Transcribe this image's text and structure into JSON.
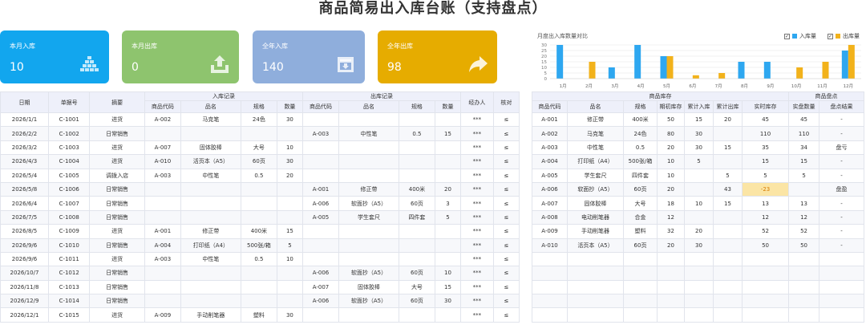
{
  "title": "商品简易出入库台账（支持盘点）",
  "tiles": [
    {
      "label": "本月入库",
      "value": "10",
      "color": "#12a6ee",
      "icon": "boxes-stack-icon"
    },
    {
      "label": "本月出库",
      "value": "0",
      "color": "#8ec46e",
      "icon": "upload-tray-icon"
    },
    {
      "label": "全年入库",
      "value": "140",
      "color": "#8faedc",
      "icon": "inbox-tray-icon"
    },
    {
      "label": "全年出库",
      "value": "98",
      "color": "#e6ac00",
      "icon": "share-arrow-icon"
    }
  ],
  "chart_data": {
    "type": "bar",
    "title": "月度出入库数量对比",
    "categories": [
      "1月",
      "2月",
      "3月",
      "4月",
      "5月",
      "6月",
      "7月",
      "8月",
      "9月",
      "10月",
      "11月",
      "12月"
    ],
    "series": [
      {
        "name": "入库量",
        "color": "#2ea7f0",
        "values": [
          30,
          0,
          10,
          30,
          20,
          0,
          0,
          15,
          15,
          0,
          0,
          25
        ]
      },
      {
        "name": "出库量",
        "color": "#f2b21b",
        "values": [
          0,
          15,
          0,
          0,
          20,
          3,
          5,
          0,
          0,
          10,
          15,
          30
        ]
      }
    ],
    "ylim": [
      0,
      30
    ],
    "yticks": [
      "0",
      "5",
      "10",
      "15",
      "20",
      "25",
      "30"
    ],
    "legend_position": "top-right",
    "grid": true
  },
  "log_table": {
    "group_headers": {
      "in": "入库记录",
      "out": "出库记录"
    },
    "headers": {
      "date": "日期",
      "doc_no": "单据号",
      "summary": "摘要",
      "in_code": "商品代码",
      "in_name": "品名",
      "in_spec": "规格",
      "in_qty": "数量",
      "out_code": "商品代码",
      "out_name": "品名",
      "out_spec": "规格",
      "out_qty": "数量",
      "handler": "经办人",
      "check": "核对"
    },
    "rows": [
      {
        "date": "2026/1/1",
        "doc": "C-1001",
        "summary": "进货",
        "in_code": "A-002",
        "in_name": "马克笔",
        "in_spec": "24色",
        "in_qty": "30",
        "out_code": "",
        "out_name": "",
        "out_spec": "",
        "out_qty": "",
        "handler": "***",
        "check": "≤"
      },
      {
        "date": "2026/2/2",
        "doc": "C-1002",
        "summary": "日常销售",
        "in_code": "",
        "in_name": "",
        "in_spec": "",
        "in_qty": "",
        "out_code": "A-003",
        "out_name": "中性笔",
        "out_spec": "0.5",
        "out_qty": "15",
        "handler": "***",
        "check": "≤"
      },
      {
        "date": "2026/3/2",
        "doc": "C-1003",
        "summary": "进货",
        "in_code": "A-007",
        "in_name": "固体胶棒",
        "in_spec": "大号",
        "in_qty": "10",
        "out_code": "",
        "out_name": "",
        "out_spec": "",
        "out_qty": "",
        "handler": "***",
        "check": "≤"
      },
      {
        "date": "2026/4/3",
        "doc": "C-1004",
        "summary": "进货",
        "in_code": "A-010",
        "in_name": "活页本（A5）",
        "in_spec": "60页",
        "in_qty": "30",
        "out_code": "",
        "out_name": "",
        "out_spec": "",
        "out_qty": "",
        "handler": "***",
        "check": "≤"
      },
      {
        "date": "2026/5/4",
        "doc": "C-1005",
        "summary": "调拨入店",
        "in_code": "A-003",
        "in_name": "中性笔",
        "in_spec": "0.5",
        "in_qty": "20",
        "out_code": "",
        "out_name": "",
        "out_spec": "",
        "out_qty": "",
        "handler": "***",
        "check": "≤"
      },
      {
        "date": "2026/5/8",
        "doc": "C-1006",
        "summary": "日常销售",
        "in_code": "",
        "in_name": "",
        "in_spec": "",
        "in_qty": "",
        "out_code": "A-001",
        "out_name": "修正带",
        "out_spec": "400米",
        "out_qty": "20",
        "handler": "***",
        "check": "≤"
      },
      {
        "date": "2026/6/4",
        "doc": "C-1007",
        "summary": "日常销售",
        "in_code": "",
        "in_name": "",
        "in_spec": "",
        "in_qty": "",
        "out_code": "A-006",
        "out_name": "软面抄（A5）",
        "out_spec": "60页",
        "out_qty": "3",
        "handler": "***",
        "check": "≤"
      },
      {
        "date": "2026/7/5",
        "doc": "C-1008",
        "summary": "日常销售",
        "in_code": "",
        "in_name": "",
        "in_spec": "",
        "in_qty": "",
        "out_code": "A-005",
        "out_name": "学生套尺",
        "out_spec": "四件套",
        "out_qty": "5",
        "handler": "***",
        "check": "≤"
      },
      {
        "date": "2026/8/5",
        "doc": "C-1009",
        "summary": "进货",
        "in_code": "A-001",
        "in_name": "修正带",
        "in_spec": "400米",
        "in_qty": "15",
        "out_code": "",
        "out_name": "",
        "out_spec": "",
        "out_qty": "",
        "handler": "***",
        "check": "≤"
      },
      {
        "date": "2026/9/6",
        "doc": "C-1010",
        "summary": "日常销售",
        "in_code": "A-004",
        "in_name": "打印纸（A4）",
        "in_spec": "500张/箱",
        "in_qty": "5",
        "out_code": "",
        "out_name": "",
        "out_spec": "",
        "out_qty": "",
        "handler": "***",
        "check": "≤"
      },
      {
        "date": "2026/9/6",
        "doc": "C-1011",
        "summary": "进货",
        "in_code": "A-003",
        "in_name": "中性笔",
        "in_spec": "0.5",
        "in_qty": "10",
        "out_code": "",
        "out_name": "",
        "out_spec": "",
        "out_qty": "",
        "handler": "***",
        "check": "≤"
      },
      {
        "date": "2026/10/7",
        "doc": "C-1012",
        "summary": "日常销售",
        "in_code": "",
        "in_name": "",
        "in_spec": "",
        "in_qty": "",
        "out_code": "A-006",
        "out_name": "软面抄（A5）",
        "out_spec": "60页",
        "out_qty": "10",
        "handler": "***",
        "check": "≤"
      },
      {
        "date": "2026/11/8",
        "doc": "C-1013",
        "summary": "日常销售",
        "in_code": "",
        "in_name": "",
        "in_spec": "",
        "in_qty": "",
        "out_code": "A-007",
        "out_name": "固体胶棒",
        "out_spec": "大号",
        "out_qty": "15",
        "handler": "***",
        "check": "≤"
      },
      {
        "date": "2026/12/9",
        "doc": "C-1014",
        "summary": "日常销售",
        "in_code": "",
        "in_name": "",
        "in_spec": "",
        "in_qty": "",
        "out_code": "A-006",
        "out_name": "软面抄（A5）",
        "out_spec": "60页",
        "out_qty": "30",
        "handler": "***",
        "check": "≤"
      },
      {
        "date": "2026/12/1",
        "doc": "C-1015",
        "summary": "进货",
        "in_code": "A-009",
        "in_name": "手动削笔器",
        "in_spec": "塑料",
        "in_qty": "30",
        "out_code": "",
        "out_name": "",
        "out_spec": "",
        "out_qty": "",
        "handler": "***",
        "check": "≤"
      }
    ]
  },
  "stock_table": {
    "group_headers": {
      "stock": "商品库存",
      "count": "商品盘点"
    },
    "headers": {
      "code": "商品代码",
      "name": "品名",
      "spec": "规格",
      "opening": "期初库存",
      "total_in": "累计入库",
      "total_out": "累计出库",
      "current": "实时库存",
      "counted": "实盘数量",
      "result": "盘点结果"
    },
    "warn_color": "#fbe5a5",
    "rows": [
      {
        "code": "A-001",
        "name": "修正带",
        "spec": "400米",
        "opening": "50",
        "total_in": "15",
        "total_out": "20",
        "current": "45",
        "counted": "45",
        "result": "-",
        "warn": false
      },
      {
        "code": "A-002",
        "name": "马克笔",
        "spec": "24色",
        "opening": "80",
        "total_in": "30",
        "total_out": "",
        "current": "110",
        "counted": "110",
        "result": "-",
        "warn": false
      },
      {
        "code": "A-003",
        "name": "中性笔",
        "spec": "0.5",
        "opening": "20",
        "total_in": "30",
        "total_out": "15",
        "current": "35",
        "counted": "34",
        "result": "盘亏",
        "warn": false
      },
      {
        "code": "A-004",
        "name": "打印纸（A4）",
        "spec": "500张/箱",
        "opening": "10",
        "total_in": "5",
        "total_out": "",
        "current": "15",
        "counted": "15",
        "result": "-",
        "warn": false
      },
      {
        "code": "A-005",
        "name": "学生套尺",
        "spec": "四件套",
        "opening": "10",
        "total_in": "",
        "total_out": "5",
        "current": "5",
        "counted": "5",
        "result": "-",
        "warn": false
      },
      {
        "code": "A-006",
        "name": "软面抄（A5）",
        "spec": "60页",
        "opening": "20",
        "total_in": "",
        "total_out": "43",
        "current": "-23",
        "counted": "",
        "result": "盘盈",
        "warn": true
      },
      {
        "code": "A-007",
        "name": "固体胶棒",
        "spec": "大号",
        "opening": "18",
        "total_in": "10",
        "total_out": "15",
        "current": "13",
        "counted": "13",
        "result": "-",
        "warn": false
      },
      {
        "code": "A-008",
        "name": "电动削笔器",
        "spec": "合金",
        "opening": "12",
        "total_in": "",
        "total_out": "",
        "current": "12",
        "counted": "12",
        "result": "-",
        "warn": false
      },
      {
        "code": "A-009",
        "name": "手动削笔器",
        "spec": "塑料",
        "opening": "32",
        "total_in": "20",
        "total_out": "",
        "current": "52",
        "counted": "52",
        "result": "-",
        "warn": false
      },
      {
        "code": "A-010",
        "name": "活页本（A5）",
        "spec": "60页",
        "opening": "20",
        "total_in": "30",
        "total_out": "",
        "current": "50",
        "counted": "50",
        "result": "-",
        "warn": false
      }
    ]
  }
}
